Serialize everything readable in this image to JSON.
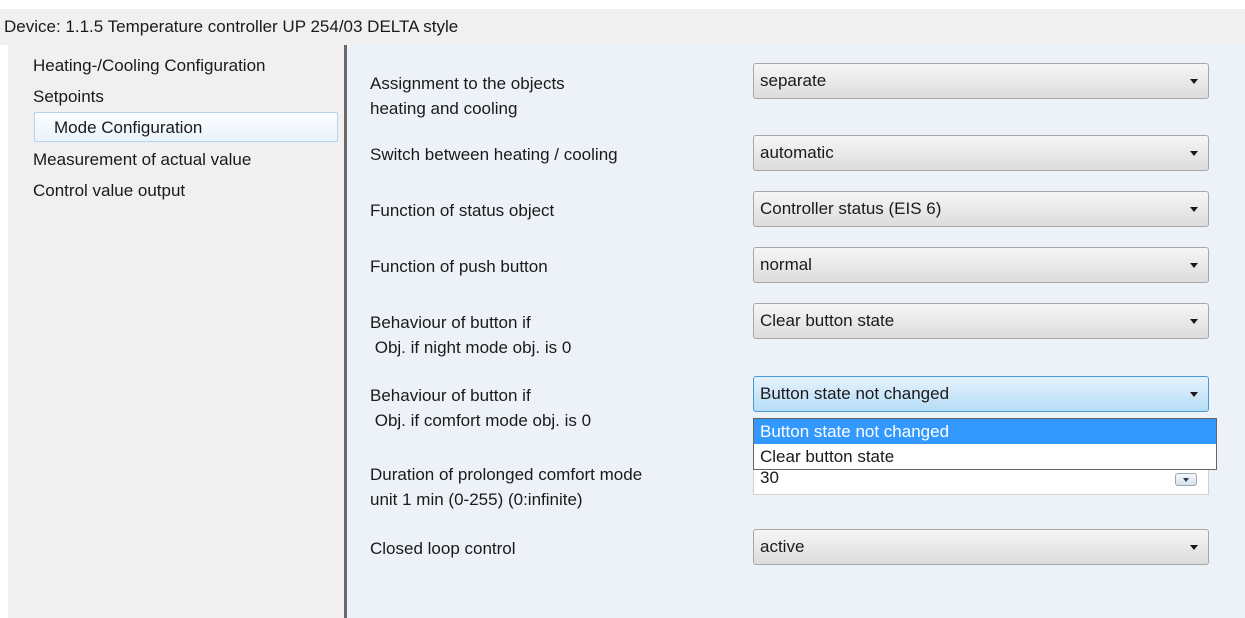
{
  "window": {
    "title": "Device: 1.1.5  Temperature controller UP 254/03 DELTA style"
  },
  "sidebar": {
    "items": [
      {
        "label": "Heating-/Cooling  Configuration",
        "selected": false
      },
      {
        "label": "Setpoints",
        "selected": false
      },
      {
        "label": "Mode  Configuration",
        "selected": true
      },
      {
        "label": "Measurement of actual value",
        "selected": false
      },
      {
        "label": "Control value output",
        "selected": false
      }
    ]
  },
  "params": {
    "assignment": {
      "label_line1": "Assignment to the objects",
      "label_line2": "heating and cooling",
      "value": "separate"
    },
    "switch_heat_cool": {
      "label": "Switch between heating / cooling",
      "value": "automatic"
    },
    "status_object": {
      "label": "Function of status object",
      "value": "Controller status (EIS 6)"
    },
    "push_button": {
      "label": "Function of push button",
      "value": "normal"
    },
    "night_mode": {
      "label_line1": "Behaviour of button if",
      "label_line2": " Obj. if night mode obj. is 0",
      "value": "Clear button state"
    },
    "comfort_mode": {
      "label_line1": "Behaviour of button if",
      "label_line2": " Obj. if comfort mode obj. is 0",
      "value": "Button state not changed",
      "options": [
        "Button state not changed",
        "Clear button state"
      ],
      "open": true
    },
    "prolonged_comfort": {
      "label_line1": "Duration of prolonged comfort mode",
      "label_line2": "unit 1 min  (0-255)  (0:infinite)",
      "value": "30"
    },
    "closed_loop": {
      "label": "Closed loop control",
      "value": "active"
    }
  },
  "colors": {
    "selection": "#3399ff",
    "panel_bg": "#edf2f9",
    "sidebar_bg": "#f0f0f0",
    "splitter": "#6b6b6b"
  }
}
